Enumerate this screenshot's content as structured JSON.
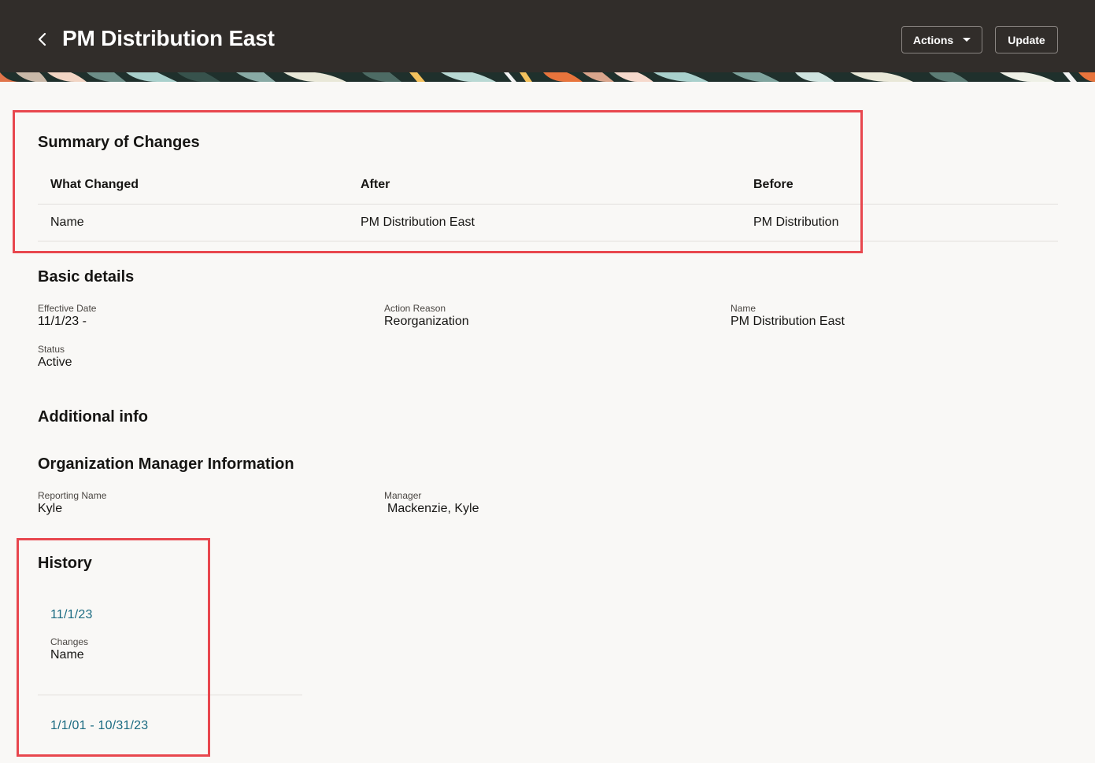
{
  "header": {
    "title": "PM Distribution East",
    "actions_label": "Actions",
    "update_label": "Update"
  },
  "summary": {
    "heading": "Summary of Changes",
    "columns": [
      "What Changed",
      "After",
      "Before"
    ],
    "rows": [
      [
        "Name",
        "PM Distribution East",
        "PM Distribution"
      ]
    ]
  },
  "basic": {
    "heading": "Basic details",
    "effective_date_label": "Effective Date",
    "effective_date_value": "11/1/23 -",
    "action_reason_label": "Action Reason",
    "action_reason_value": "Reorganization",
    "name_label": "Name",
    "name_value": "PM Distribution East",
    "status_label": "Status",
    "status_value": "Active"
  },
  "additional": {
    "heading": "Additional info"
  },
  "manager_info": {
    "heading": "Organization Manager Information",
    "reporting_name_label": "Reporting Name",
    "reporting_name_value": "Kyle",
    "manager_label": "Manager",
    "manager_value": "Mackenzie, Kyle"
  },
  "history": {
    "heading": "History",
    "entries": [
      {
        "date": "11/1/23",
        "changes_label": "Changes",
        "changes_value": "Name"
      },
      {
        "date": "1/1/01 - 10/31/23"
      }
    ]
  },
  "colors": {
    "header_bg": "#312d2a",
    "page_bg": "#f9f8f6",
    "link": "#1b6b82",
    "highlight": "#e8474e"
  }
}
